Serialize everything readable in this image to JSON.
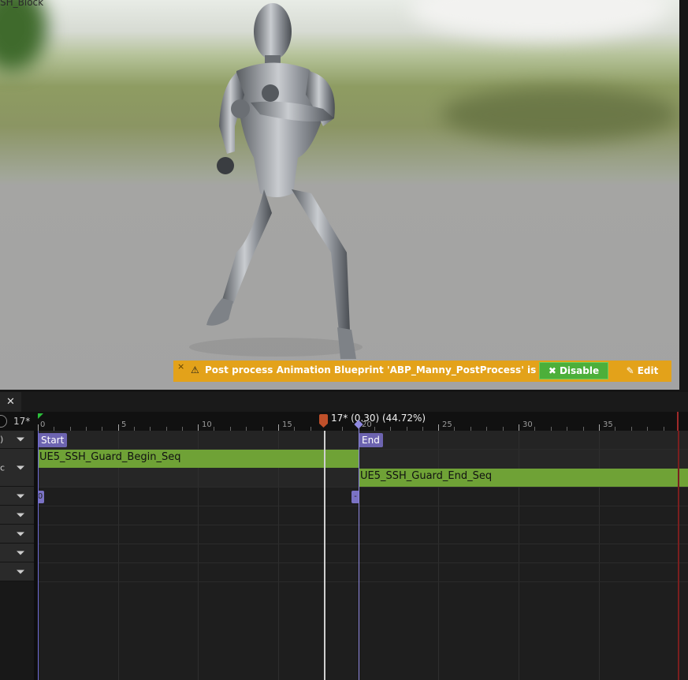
{
  "viewport": {
    "title_partial": "SH_Block",
    "banner": {
      "close_glyph": "×",
      "warning_icon": "warning-triangle-icon",
      "message": "Post process Animation Blueprint 'ABP_Manny_PostProcess' is running.",
      "disable_label": "Disable",
      "disable_icon": "✖",
      "edit_label": "Edit",
      "edit_icon": "✎",
      "bg_color": "#e3a21a",
      "button_color": "#4caf3a"
    }
  },
  "timeline": {
    "tab_close_glyph": "✕",
    "current_frame_field": "17*",
    "ruler_ticks": [
      "0",
      "5",
      "10",
      "15",
      "20",
      "25",
      "30",
      "35"
    ],
    "playhead_label": "17* (0.30) (44.72%)",
    "playhead_progress": 0.4472,
    "row_headers": [
      {
        "label": ")",
        "dropdown": true
      },
      {
        "label": "c",
        "dropdown": true
      },
      {
        "label": "",
        "dropdown": true
      },
      {
        "label": "",
        "dropdown": true
      },
      {
        "label": "",
        "dropdown": true
      },
      {
        "label": "",
        "dropdown": true
      },
      {
        "label": "",
        "dropdown": true
      }
    ],
    "notifies": {
      "start_label": "Start",
      "end_label": "End",
      "small_key_left": "0",
      "small_key_right": "-"
    },
    "segments": {
      "begin": "UE5_SSH_Guard_Begin_Seq",
      "end": "UE5_SSH_Guard_End_Seq"
    },
    "colors": {
      "segment": "#6fa236",
      "notify": "#6d64b0",
      "playhead": "#c0502a"
    }
  }
}
